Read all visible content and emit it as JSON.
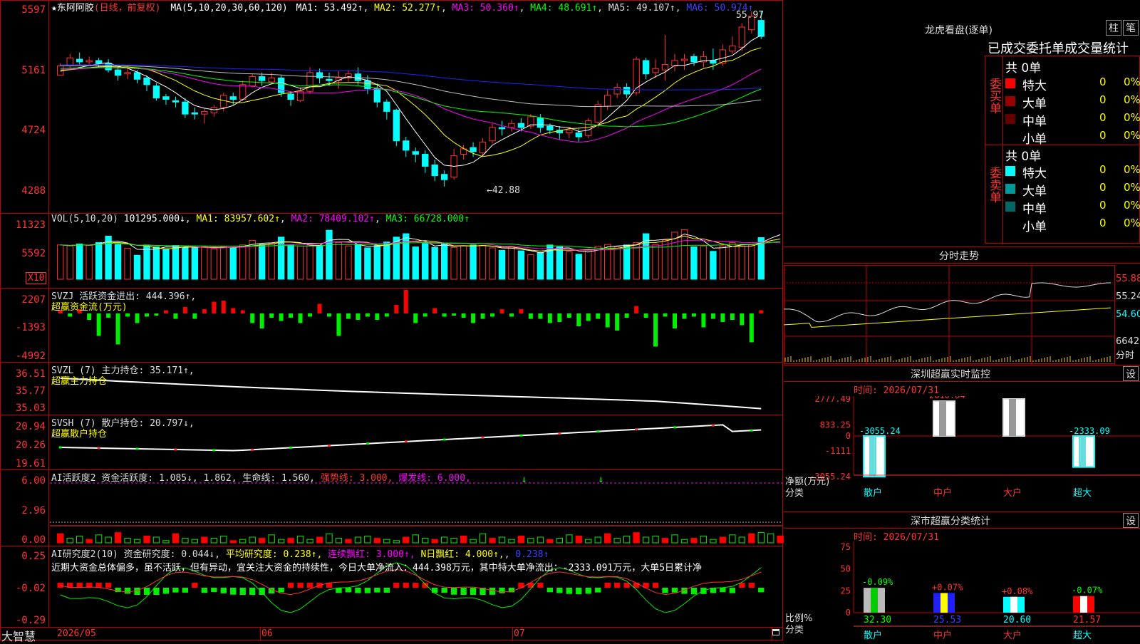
{
  "stock": {
    "name": "★东阿阿胶",
    "mode": "(日线，前复权)",
    "ma_header": "MA(5,10,20,30,60,120)",
    "ma_values": [
      "MA1: 53.492↑",
      "MA2: 52.277↑",
      "MA3: 50.360↑",
      "MA4: 48.691↑",
      "MA5: 49.107↑",
      "MA6: 50.974↑"
    ],
    "ma_colors": [
      "#ffffff",
      "#ffff00",
      "#ff00ff",
      "#00ff00",
      "#c0c0c0",
      "#2020ff"
    ],
    "high_label": "55.97",
    "low_label": "←42.88",
    "yticks": [
      "5597",
      "5161",
      "4724",
      "4288"
    ],
    "candles": [
      [
        51.2,
        51.9,
        51.6,
        52.1
      ],
      [
        51.9,
        52.5,
        51.7,
        52.8
      ],
      [
        52.4,
        52.2,
        52.0,
        52.9
      ],
      [
        52.2,
        52.3,
        51.9,
        52.6
      ],
      [
        52.3,
        52.1,
        51.8,
        52.5
      ],
      [
        52.1,
        51.6,
        51.4,
        52.4
      ],
      [
        51.6,
        51.2,
        50.8,
        51.8
      ],
      [
        51.3,
        51.4,
        50.9,
        51.9
      ],
      [
        51.4,
        50.9,
        50.6,
        51.6
      ],
      [
        51.0,
        50.5,
        50.0,
        51.2
      ],
      [
        50.4,
        49.5,
        49.3,
        50.6
      ],
      [
        49.6,
        49.4,
        49.0,
        49.8
      ],
      [
        49.3,
        49.2,
        48.8,
        49.6
      ],
      [
        49.2,
        48.3,
        48.0,
        49.5
      ],
      [
        48.4,
        48.3,
        47.9,
        48.8
      ],
      [
        48.3,
        48.5,
        47.6,
        48.7
      ],
      [
        48.4,
        48.8,
        48.1,
        49.0
      ],
      [
        48.8,
        49.7,
        48.5,
        49.9
      ],
      [
        49.6,
        49.4,
        49.0,
        49.9
      ],
      [
        49.4,
        50.5,
        49.3,
        50.8
      ],
      [
        50.4,
        51.1,
        50.3,
        51.3
      ],
      [
        51.1,
        50.8,
        50.4,
        51.4
      ],
      [
        50.7,
        51.0,
        50.5,
        51.4
      ],
      [
        51.0,
        49.9,
        49.6,
        51.2
      ],
      [
        49.8,
        49.4,
        48.9,
        50.0
      ],
      [
        49.3,
        50.0,
        49.2,
        50.3
      ],
      [
        50.0,
        51.4,
        49.8,
        51.8
      ],
      [
        51.4,
        51.0,
        50.6,
        51.7
      ],
      [
        50.9,
        50.8,
        50.4,
        51.4
      ],
      [
        50.8,
        51.0,
        50.2,
        51.5
      ],
      [
        51.0,
        51.3,
        50.7,
        51.6
      ],
      [
        51.3,
        50.8,
        50.5,
        51.8
      ],
      [
        50.8,
        50.2,
        49.8,
        51.2
      ],
      [
        50.2,
        49.2,
        48.8,
        50.6
      ],
      [
        49.2,
        48.5,
        47.9,
        49.4
      ],
      [
        48.6,
        46.3,
        45.9,
        48.7
      ],
      [
        46.3,
        45.6,
        45.1,
        46.6
      ],
      [
        45.5,
        45.3,
        44.7,
        45.8
      ],
      [
        45.3,
        44.4,
        43.9,
        45.6
      ],
      [
        44.5,
        43.7,
        43.3,
        44.9
      ],
      [
        43.8,
        43.4,
        42.88,
        44.1
      ],
      [
        43.6,
        45.2,
        43.4,
        45.7
      ],
      [
        45.3,
        45.7,
        44.9,
        46.0
      ],
      [
        45.8,
        45.5,
        45.1,
        46.2
      ],
      [
        45.4,
        46.2,
        45.2,
        46.5
      ],
      [
        46.3,
        47.3,
        46.1,
        47.6
      ],
      [
        47.3,
        47.2,
        46.7,
        47.8
      ],
      [
        47.3,
        47.6,
        47.0,
        47.9
      ],
      [
        47.6,
        47.3,
        47.0,
        48.0
      ],
      [
        47.4,
        48.1,
        47.2,
        48.3
      ],
      [
        48.0,
        47.3,
        46.9,
        48.3
      ],
      [
        47.4,
        47.1,
        46.8,
        47.6
      ],
      [
        47.1,
        46.9,
        46.4,
        47.4
      ],
      [
        46.9,
        47.1,
        46.5,
        47.3
      ],
      [
        46.9,
        46.6,
        46.2,
        47.2
      ],
      [
        46.7,
        47.8,
        46.5,
        48.0
      ],
      [
        47.7,
        49.0,
        47.3,
        49.3
      ],
      [
        48.9,
        49.7,
        48.6,
        50.1
      ],
      [
        49.8,
        50.3,
        49.5,
        50.6
      ],
      [
        50.3,
        49.8,
        49.5,
        50.6
      ],
      [
        49.9,
        52.4,
        49.7,
        52.6
      ],
      [
        52.3,
        51.3,
        50.9,
        52.5
      ],
      [
        51.4,
        51.7,
        51.0,
        52.4
      ],
      [
        51.6,
        52.0,
        50.8,
        54.2
      ],
      [
        51.9,
        52.3,
        51.5,
        52.8
      ],
      [
        52.3,
        52.4,
        51.6,
        52.8
      ],
      [
        52.6,
        52.2,
        51.9,
        52.8
      ],
      [
        52.2,
        52.6,
        51.8,
        53.0
      ],
      [
        52.3,
        52.1,
        51.6,
        53.2
      ],
      [
        52.1,
        53.1,
        51.9,
        53.5
      ],
      [
        53.0,
        53.4,
        52.8,
        54.1
      ],
      [
        53.3,
        54.8,
        53.0,
        55.1
      ],
      [
        54.6,
        55.6,
        54.3,
        55.97
      ],
      [
        55.3,
        54.1,
        53.9,
        56.0
      ]
    ],
    "vol_header": "VOL(5,10,20)",
    "vol_values": [
      "101295.000↓",
      "MA1: 83957.602↑",
      "MA2: 78409.102↑",
      "MA3: 66728.000↑"
    ],
    "vol_colors": [
      "#ffffff",
      "#ffff00",
      "#ff00ff",
      "#00ff00"
    ],
    "vol_yticks": [
      "11323",
      "5592"
    ],
    "vol_unit": "X10",
    "volumes": [
      7.0,
      6.8,
      7.2,
      6.9,
      7.5,
      8.8,
      7.1,
      6.3,
      4.9,
      7.0,
      6.6,
      6.2,
      6.9,
      6.5,
      6.4,
      6.6,
      6.2,
      6.7,
      6.4,
      7.0,
      7.9,
      7.1,
      7.3,
      8.6,
      7.0,
      6.8,
      7.0,
      6.9,
      10.0,
      7.5,
      6.8,
      7.0,
      6.4,
      6.9,
      7.6,
      8.6,
      9.3,
      6.6,
      7.3,
      6.5,
      7.2,
      6.5,
      6.8,
      7.0,
      6.9,
      6.4,
      5.9,
      6.7,
      5.8,
      5.0,
      5.4,
      7.0,
      6.6,
      5.6,
      5.1,
      6.0,
      6.7,
      7.1,
      6.6,
      7.0,
      7.5,
      9.3,
      7.1,
      8.0,
      9.6,
      10.1,
      6.6,
      6.8,
      5.7,
      6.8,
      7.5,
      6.8,
      7.0,
      8.5,
      9.6,
      9.2
    ],
    "svzj_header": "SVZJ  活跃资金进出: 444.396↑,",
    "svzj_sub": "超赢资金流(万元)",
    "svzj_yticks": [
      "2207",
      "-1393",
      "-4992"
    ],
    "svzj": [
      0.3,
      -0.3,
      0.4,
      -0.6,
      -2.1,
      -0.4,
      -2.9,
      -0.3,
      -0.9,
      -0.3,
      -0.2,
      0.3,
      -0.5,
      0.6,
      -0.5,
      0.4,
      1.1,
      1.2,
      0.5,
      0.3,
      -0.9,
      -1.4,
      -0.4,
      -0.7,
      -0.4,
      -0.9,
      -0.3,
      0.9,
      -0.3,
      -2.1,
      -0.5,
      -0.6,
      -0.3,
      -0.6,
      -0.3,
      0.8,
      2.2,
      -0.9,
      -0.3,
      0.5,
      -0.3,
      -0.2,
      -0.4,
      -0.9,
      -0.5,
      -0.3,
      0.4,
      -0.3,
      0.4,
      -0.5,
      -0.5,
      -0.9,
      -0.8,
      -0.4,
      -1.2,
      -0.7,
      -0.5,
      -1.3,
      -1.6,
      -0.4,
      0.7,
      -0.4,
      -3.1,
      -0.3,
      -1.4,
      -0.5,
      -0.3,
      -1.3,
      -0.5,
      -0.8,
      -0.6,
      -1.1,
      -2.7,
      0.3
    ],
    "svzl_header": "SVZL (7) 主力持仓: 35.171↑,",
    "svzl_sub": "超赢主力持仓",
    "svzl_yticks": [
      "36.51",
      "35.77",
      "35.03"
    ],
    "svsh_header": "SVSH (7) 散户持仓: 20.797↓,",
    "svsh_sub": "超赢散户持仓",
    "svsh_yticks": [
      "20.94",
      "20.26",
      "19.61"
    ],
    "ai_header": "AI活跃度2 资金活跃度: 1.085↓, 1.862, 生命线: 1.560,",
    "ai_strong": "强势线: 3.000,",
    "ai_burst": "爆发线: 6.000,",
    "ai_yticks": [
      "6.00",
      "2.96",
      "0.00"
    ],
    "ai_bars": [
      0.8,
      0.4,
      0.6,
      0.3,
      0.7,
      0.5,
      0.9,
      0.4,
      0.3,
      0.6,
      0.5,
      0.2,
      0.8,
      0.4,
      0.3,
      0.5,
      0.4,
      0.6,
      0.2,
      0.3,
      0.5,
      0.4,
      0.7,
      0.3,
      0.4,
      0.6,
      0.3,
      0.5,
      0.8,
      0.4,
      0.3,
      0.5,
      0.6,
      0.4,
      0.3,
      0.2,
      0.5,
      0.7,
      0.4,
      0.3,
      0.5,
      0.4,
      0.6,
      0.3,
      0.8,
      0.4,
      0.5,
      0.3,
      0.6,
      0.4,
      0.5,
      0.3,
      0.4,
      0.7,
      0.6,
      0.3,
      0.5,
      0.8,
      0.4,
      0.6,
      0.9,
      0.5,
      0.6,
      0.4,
      0.7,
      0.3,
      0.4,
      0.6,
      0.3,
      0.5,
      0.7,
      0.5,
      0.8,
      0.9,
      0.8,
      0.6
    ],
    "yj_header": "AI研究度2(10) 资金研究度: 0.044↓,",
    "yj_avg": "平均研究度: 0.238↑,",
    "yj_red": "连续飘红: 3.000↑,",
    "yj_nred": "N日飘红: 4.000↑,",
    "yj_last": "0.238↑",
    "yj_note": "近期大资金总体偏多，虽不活跃，但有异动，宜关注大资金的持续性，今日大单净流入：444.398万元，其中特大单净流出：-2333.091万元，大单5日累计净",
    "yj_yticks": [
      "0.25",
      "-0.02",
      "-0.29"
    ],
    "dates": [
      "2026/05",
      "06",
      "07"
    ],
    "brand": "大智慧"
  },
  "panel": {
    "title": "龙虎看盘(逐单)",
    "btn1": "柱",
    "btn2": "笔",
    "tab": "已成交委托单成交量统计",
    "buy_label": "委买单",
    "sell_label": "委卖单",
    "buy_total": "共 0单",
    "sell_total": "共 0单",
    "buy_rows": [
      {
        "label": "特大",
        "count": "0",
        "pct": "0%",
        "color": "#ff0000"
      },
      {
        "label": "大单",
        "count": "0",
        "pct": "0%",
        "color": "#990000"
      },
      {
        "label": "中单",
        "count": "0",
        "pct": "0%",
        "color": "#660000"
      },
      {
        "label": "小单",
        "count": "0",
        "pct": "0%",
        "color": "#000"
      }
    ],
    "sell_rows": [
      {
        "label": "特大",
        "count": "0",
        "pct": "0%",
        "color": "#00ffff"
      },
      {
        "label": "大单",
        "count": "0",
        "pct": "0%",
        "color": "#009999"
      },
      {
        "label": "中单",
        "count": "0",
        "pct": "0%",
        "color": "#006666"
      },
      {
        "label": "小单",
        "count": "0",
        "pct": "0%",
        "color": "#000"
      }
    ],
    "fs_title": "分时走势",
    "fs_price_hi": "55.88",
    "fs_price_mid": "55.24",
    "fs_price_lo": "54.60",
    "fs_vol": "6642",
    "fs_unit": "分时",
    "mon_title": "深圳超赢实时监控",
    "mon_set": "设",
    "mon_time": "时间: 2026/07/31",
    "mon_yticks": [
      "2777.49",
      "833.25",
      "0",
      "-1111",
      "-3055.24"
    ],
    "mon_cats": [
      "散户",
      "中户",
      "大户",
      "超大"
    ],
    "mon_values": [
      -3055.24,
      2610.84,
      2777.49,
      -2333.09
    ],
    "mon_labels": [
      "-3055.24",
      "2610.84",
      "2777.49",
      "-2333.09"
    ],
    "mon_axis1": "净额(万元)",
    "mon_axis2": "分类",
    "cls_title": "深市超赢分类统计",
    "cls_set": "设",
    "cls_time": "时间: 2026/07/31",
    "cls_yticks": [
      "75",
      "50",
      "25",
      "0"
    ],
    "cls_values": [
      32.3,
      25.53,
      20.6,
      21.57
    ],
    "cls_labels": [
      "32.30",
      "25.53",
      "20.60",
      "21.57"
    ],
    "cls_delta": [
      "-0.09%",
      "+0.07%",
      "+0.08%",
      "-0.07%"
    ],
    "cls_axis1": "比例%",
    "cls_axis2": "分类"
  },
  "chart_data": [
    {
      "type": "candlestick",
      "title": "东阿阿胶 日线 前复权",
      "ylim": [
        42.8,
        56.2
      ],
      "annotations": [
        "55.97",
        "42.88"
      ],
      "categories_note": "2026/05 - 2026/07"
    },
    {
      "type": "bar",
      "title": "深圳超赢实时监控",
      "categories": [
        "散户",
        "中户",
        "大户",
        "超大"
      ],
      "values": [
        -3055.24,
        2610.84,
        2777.49,
        -2333.09
      ],
      "ylabel": "净额(万元)"
    },
    {
      "type": "bar",
      "title": "深市超赢分类统计",
      "categories": [
        "散户",
        "中户",
        "大户",
        "超大"
      ],
      "values": [
        32.3,
        25.53,
        20.6,
        21.57
      ],
      "ylabel": "比例%",
      "ylim": [
        0,
        75
      ]
    }
  ]
}
